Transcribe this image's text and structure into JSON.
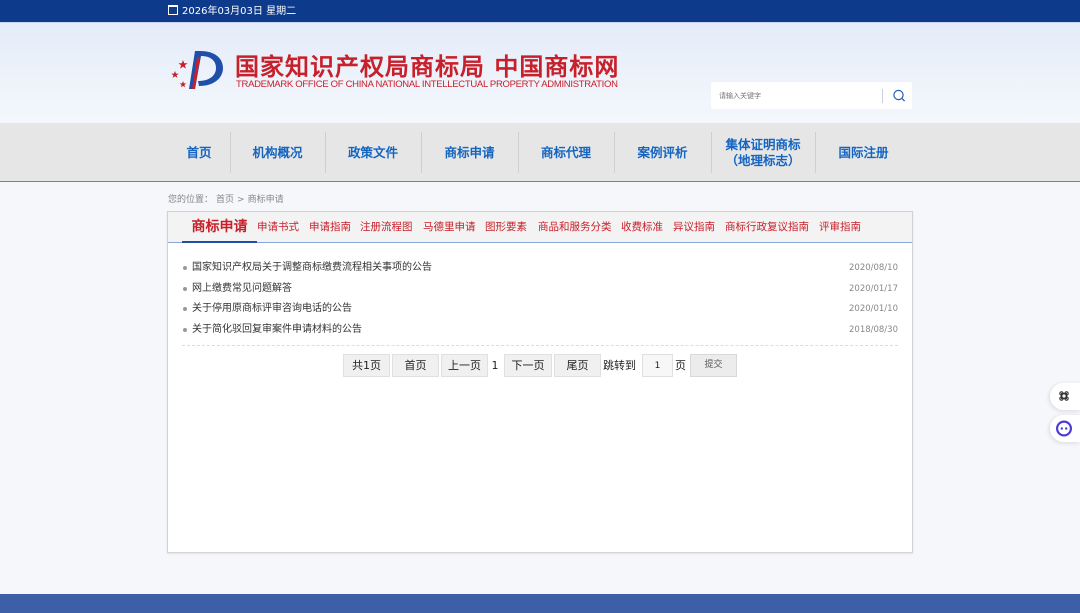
{
  "topbar": {
    "date": "2026年03月03日 星期二",
    "icon": "calendar-icon"
  },
  "header": {
    "title_cn": "国家知识产权局商标局 中国商标网",
    "title_en": "TRADEMARK OFFICE OF CHINA NATIONAL INTELLECTUAL PROPERTY ADMINISTRATION",
    "search": {
      "placeholder": "请输入关键字",
      "icon": "search-icon"
    },
    "brand_color": "#c8202a"
  },
  "nav": {
    "items": [
      {
        "label": "首页"
      },
      {
        "label": "机构概况"
      },
      {
        "label": "政策文件"
      },
      {
        "label": "商标申请"
      },
      {
        "label": "商标代理"
      },
      {
        "label": "案例评析"
      },
      {
        "label": "集体证明商标\n（地理标志）"
      },
      {
        "label": "国际注册"
      }
    ],
    "color": "#1565c0"
  },
  "breadcrumb": {
    "prefix": "您的位置：",
    "home": "首页",
    "sep": ">",
    "current": "商标申请"
  },
  "tabs": {
    "main": "商标申请",
    "items": [
      "申请书式",
      "申请指南",
      "注册流程图",
      "马德里申请",
      "图形要素",
      "商品和服务分类",
      "收费标准",
      "异议指南",
      "商标行政复议指南",
      "评审指南"
    ]
  },
  "list": [
    {
      "title": "国家知识产权局关于调整商标缴费流程相关事项的公告",
      "date": "2020/08/10"
    },
    {
      "title": "网上缴费常见问题解答",
      "date": "2020/01/17"
    },
    {
      "title": "关于停用原商标评审咨询电话的公告",
      "date": "2020/01/10"
    },
    {
      "title": "关于简化驳回复审案件申请材料的公告",
      "date": "2018/08/30"
    }
  ],
  "pager": {
    "total": "共1页",
    "first": "首页",
    "prev": "上一页",
    "current": "1",
    "next": "下一页",
    "last": "尾页",
    "jump_label": "跳转到",
    "jump_value": "1",
    "page_unit": "页",
    "submit": "提交"
  },
  "floating": [
    {
      "icon": "command-icon"
    },
    {
      "icon": "assistant-icon"
    }
  ],
  "colors": {
    "topbar": "#0e3a8c",
    "footer": "#3d5fa8",
    "accent_red": "#c8202a"
  }
}
